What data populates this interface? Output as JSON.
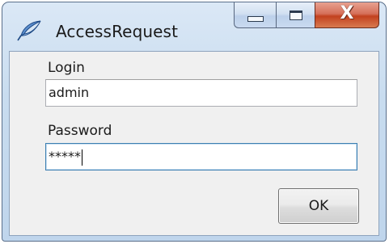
{
  "window": {
    "title": "AccessRequest",
    "app_icon": "feather-icon"
  },
  "caption_buttons": {
    "minimize_icon": "minimize-icon",
    "maximize_icon": "maximize-icon",
    "close_glyph": "X"
  },
  "form": {
    "login_label": "Login",
    "login_value": "admin",
    "password_label": "Password",
    "password_value": "*****",
    "ok_label": "OK"
  },
  "colors": {
    "frame": "#c8dcef",
    "client": "#f0f0f0",
    "close_button": "#c2411f",
    "focus_border": "#3c7fb1"
  }
}
